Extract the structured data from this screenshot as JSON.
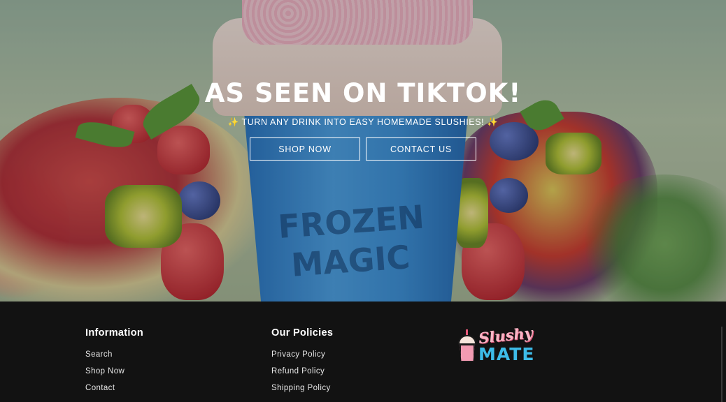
{
  "hero": {
    "title": "AS SEEN ON TIKTOK!",
    "subtitle_spark_left": "✨",
    "subtitle": "TURN ANY DRINK INTO EASY HOMEMADE SLUSHIES!",
    "subtitle_spark_right": "✨",
    "cup_emboss_line1": "FROZEN",
    "cup_emboss_line2": "MAGIC",
    "buttons": {
      "shop_now": "SHOP NOW",
      "contact_us": "CONTACT US"
    }
  },
  "footer": {
    "information": {
      "heading": "Information",
      "links": [
        "Search",
        "Shop Now",
        "Contact"
      ]
    },
    "policies": {
      "heading": "Our Policies",
      "links": [
        "Privacy Policy",
        "Refund Policy",
        "Shipping Policy"
      ]
    },
    "logo": {
      "line1": "Slushy",
      "line2": "MATE"
    }
  },
  "colors": {
    "footer_bg": "#121212",
    "hero_text": "#ffffff",
    "logo_pink": "#f7b7c6",
    "logo_blue": "#3dbbe8"
  },
  "icons": [
    "sparkles-icon",
    "slushy-cup-logo-icon"
  ]
}
